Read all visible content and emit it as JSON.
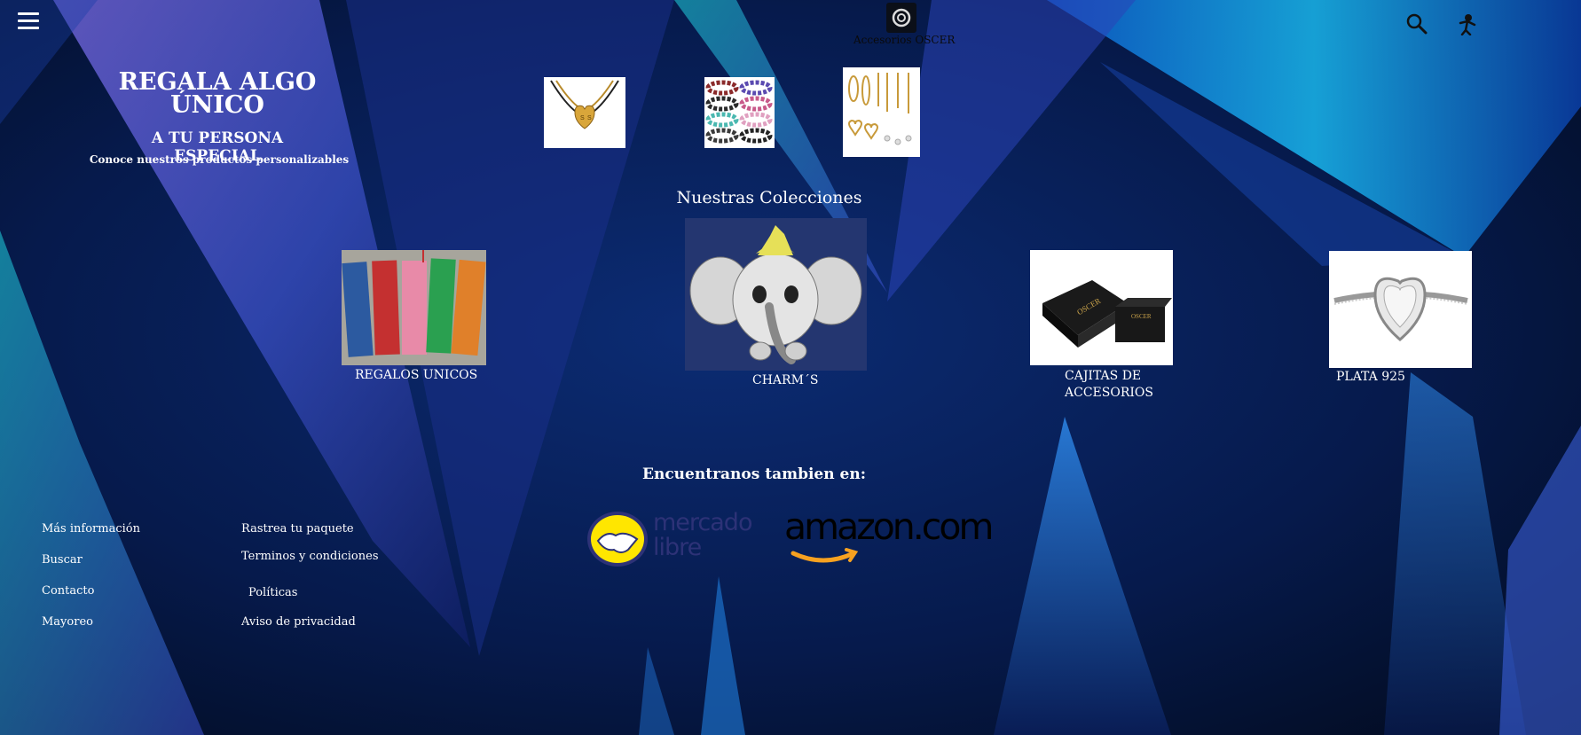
{
  "header": {
    "brand_name": "Accesorios OSCER",
    "menu_icon": "hamburger-menu-icon",
    "search_icon": "search-icon",
    "user_icon": "user-icon"
  },
  "hero": {
    "title": "REGALA ALGO ÚNICO",
    "subtitle": "A TU PERSONA ESPECIAL",
    "tagline": "Conoce nuestros productos personalizables"
  },
  "featured": [
    {
      "name": "heart-necklace-image"
    },
    {
      "name": "beaded-bracelets-image"
    },
    {
      "name": "gold-earrings-image"
    }
  ],
  "collections": {
    "title": "Nuestras Colecciones",
    "items": [
      {
        "label": "REGALOS UNICOS"
      },
      {
        "label": "CHARM´S"
      },
      {
        "label": "CAJITAS DE ACCESORIOS"
      },
      {
        "label": "PLATA 925"
      }
    ]
  },
  "partners": {
    "title": "Encuentranos tambien en:",
    "mercado_libre": {
      "line1": "mercado",
      "line2": "libre"
    },
    "amazon": {
      "text": "amazon.com"
    }
  },
  "footer": {
    "col1": [
      "Más información",
      "Buscar",
      "Contacto",
      "Mayoreo"
    ],
    "col2": [
      "Rastrea tu paquete",
      "Terminos y condiciones",
      "Políticas",
      "Aviso de privacidad"
    ]
  },
  "colors": {
    "background": "#040d24",
    "accent_blue": "#2b6fd6",
    "accent_cyan": "#18b7e8",
    "accent_purple": "#6a4bd8",
    "mercado_yellow": "#ffe600",
    "amazon_orange": "#f7a120"
  }
}
